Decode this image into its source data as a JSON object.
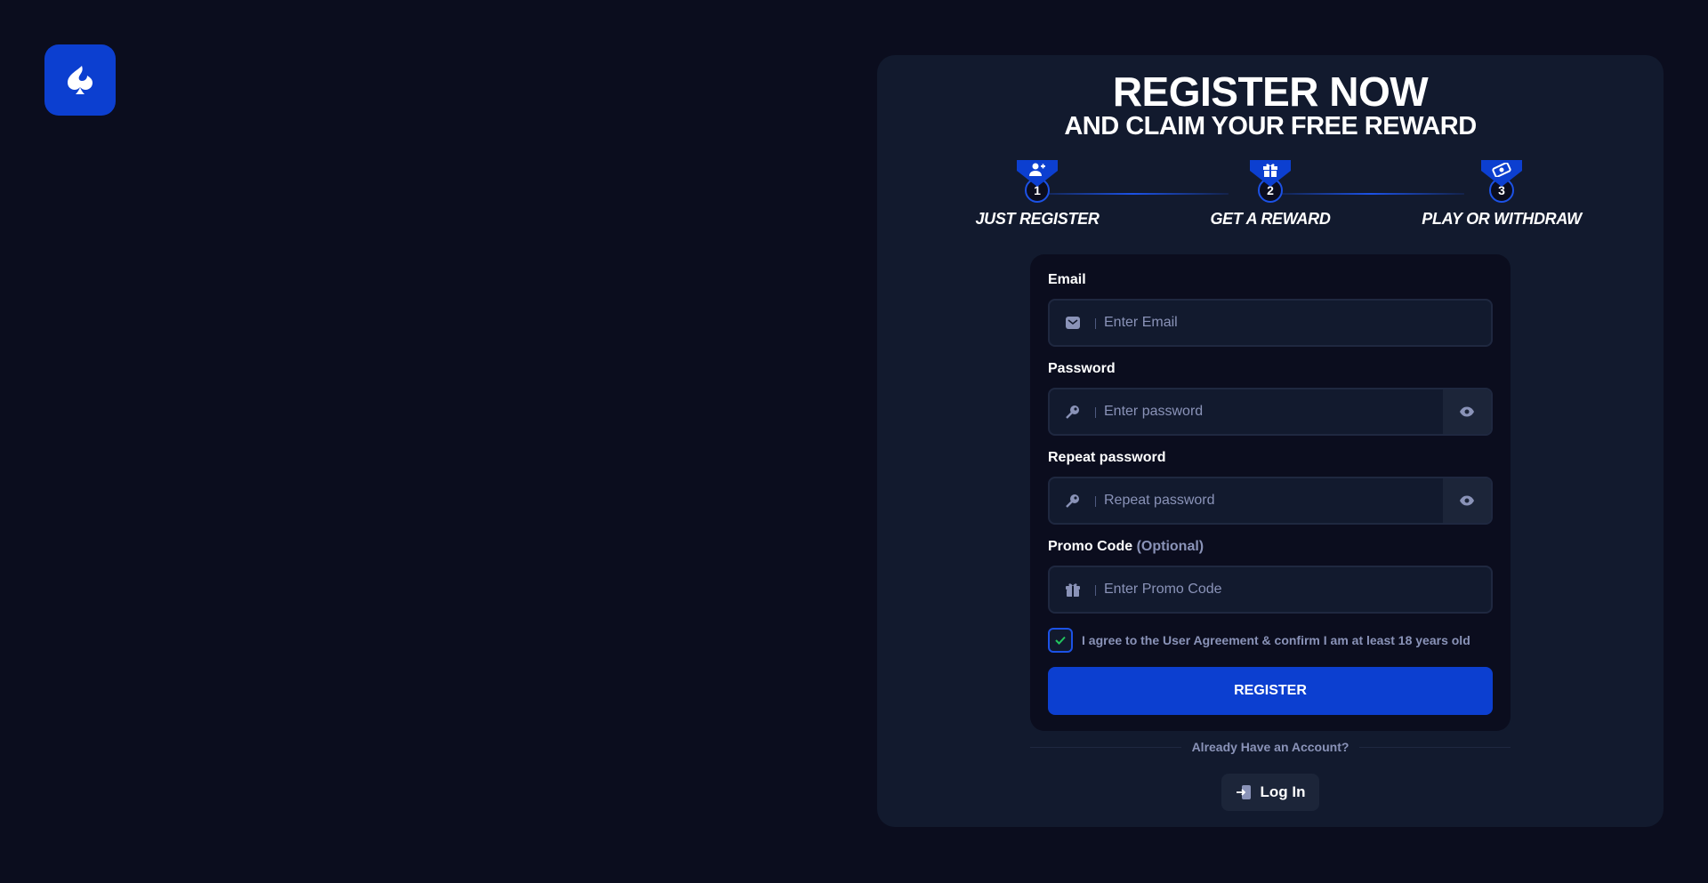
{
  "brand": {
    "logo_icon": "spade-icon",
    "accent": "#0c3fd0"
  },
  "header": {
    "title": "REGISTER NOW",
    "subtitle": "AND CLAIM YOUR FREE REWARD"
  },
  "steps": [
    {
      "number": "1",
      "label": "JUST REGISTER",
      "icon": "add-user-icon"
    },
    {
      "number": "2",
      "label": "GET A REWARD",
      "icon": "gift-icon"
    },
    {
      "number": "3",
      "label": "PLAY OR WITHDRAW",
      "icon": "cash-icon"
    }
  ],
  "form": {
    "email": {
      "label": "Email",
      "placeholder": "Enter Email",
      "value": ""
    },
    "password": {
      "label": "Password",
      "placeholder": "Enter password",
      "value": ""
    },
    "repeat_password": {
      "label": "Repeat password",
      "placeholder": "Repeat password",
      "value": ""
    },
    "promo": {
      "label": "Promo Code",
      "optional": "(Optional)",
      "placeholder": "Enter Promo Code",
      "value": ""
    },
    "agree": {
      "text": "I agree to the User Agreement & confirm I am at least 18 years old",
      "checked": true
    },
    "submit_label": "REGISTER"
  },
  "footer": {
    "already_text": "Already Have an Account?",
    "login_label": "Log In"
  }
}
